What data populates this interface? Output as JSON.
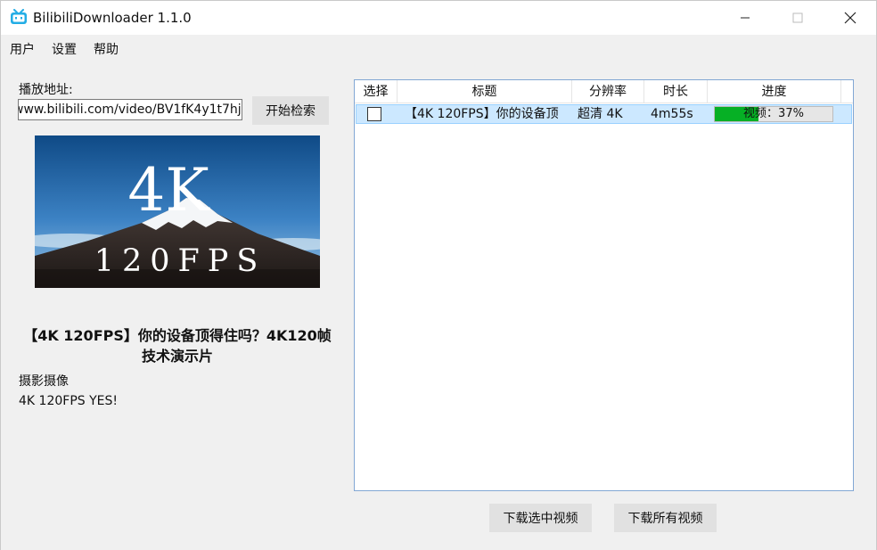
{
  "window": {
    "title": "BilibiliDownloader 1.1.0"
  },
  "menu": {
    "items": [
      "用户",
      "设置",
      "帮助"
    ]
  },
  "left": {
    "url_label": "播放地址:",
    "url_value": "www.bilibili.com/video/BV1fK4y1t7hj",
    "search_button": "开始检索",
    "thumbnail": {
      "line1": "4K",
      "line2": "120FPS"
    },
    "video_title": "【4K 120FPS】你的设备顶得住吗？4K120帧技术演示片",
    "category": "摄影摄像",
    "description": "4K 120FPS YES!"
  },
  "table": {
    "headers": [
      "选择",
      "标题",
      "分辨率",
      "时长",
      "进度"
    ],
    "rows": [
      {
        "checked": false,
        "title": "【4K 120FPS】你的设备顶",
        "resolution": "超清 4K",
        "duration": "4m55s",
        "progress_label": "视频：37%",
        "progress": 37
      }
    ]
  },
  "buttons": {
    "download_selected": "下载选中视频",
    "download_all": "下载所有视频"
  },
  "colors": {
    "accent_selection": "#cce8ff",
    "progress_fill": "#06b025",
    "bilibili_icon": "#23ade5"
  }
}
